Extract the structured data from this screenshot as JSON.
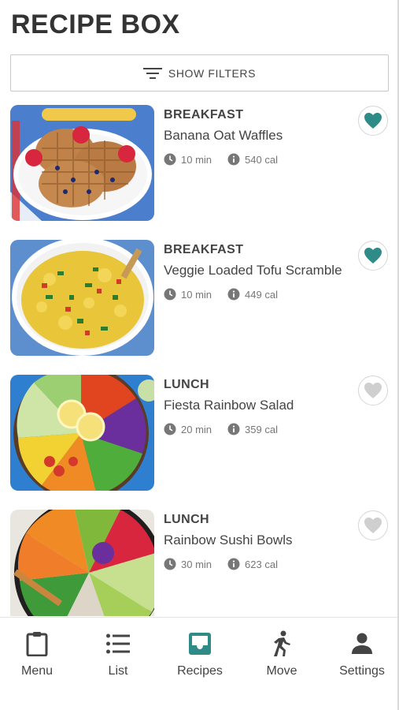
{
  "header": {
    "title": "RECIPE BOX"
  },
  "filters": {
    "label": "SHOW FILTERS",
    "icon": "filter-lines-icon"
  },
  "colors": {
    "accent": "#2e8b87",
    "text": "#444444",
    "muted": "#777777",
    "heart_inactive": "#cfcfcf"
  },
  "recipes": [
    {
      "category": "BREAKFAST",
      "name": "Banana Oat Waffles",
      "time": "10 min",
      "calories": "540 cal",
      "favorited": true
    },
    {
      "category": "BREAKFAST",
      "name": "Veggie Loaded Tofu Scramble",
      "time": "10 min",
      "calories": "449 cal",
      "favorited": true
    },
    {
      "category": "LUNCH",
      "name": "Fiesta Rainbow Salad",
      "time": "20 min",
      "calories": "359 cal",
      "favorited": false
    },
    {
      "category": "LUNCH",
      "name": "Rainbow Sushi Bowls",
      "time": "30 min",
      "calories": "623 cal",
      "favorited": false
    }
  ],
  "nav": {
    "active": "Recipes",
    "items": [
      {
        "label": "Menu",
        "icon": "clipboard-icon"
      },
      {
        "label": "List",
        "icon": "list-icon"
      },
      {
        "label": "Recipes",
        "icon": "inbox-tray-icon"
      },
      {
        "label": "Move",
        "icon": "walking-person-icon"
      },
      {
        "label": "Settings",
        "icon": "person-icon"
      }
    ]
  }
}
